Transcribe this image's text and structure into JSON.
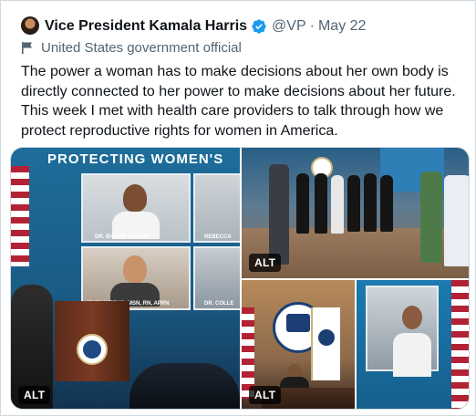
{
  "tweet": {
    "author_name": "Vice President Kamala Harris",
    "handle": "@VP",
    "separator": "·",
    "date": "May 22",
    "account_label": "United States government official",
    "text": "The power a woman has to make decisions about her own body is directly connected to her power to make decisions about her future. This week I met with health care providers to talk through how we protect reproductive rights for women in America."
  },
  "media": {
    "tile1": {
      "alt_badge": "ALT",
      "banner": "PROTECTING WOMEN'S",
      "captions": [
        "DR. BHAVIK KUMAR",
        "REBECCA",
        "HELEN WEEMS, MSN, RN, APRN",
        "DR. COLLE"
      ]
    },
    "tile2": {
      "alt_badge": "ALT"
    },
    "tile3": {
      "alt_badge": "ALT"
    },
    "tile4": {},
    "colors": {
      "verified": "#1d9bf0",
      "badge_bg": "#000000"
    }
  },
  "icons": {
    "verified": "verified-badge-icon",
    "government_label": "flag-icon"
  }
}
